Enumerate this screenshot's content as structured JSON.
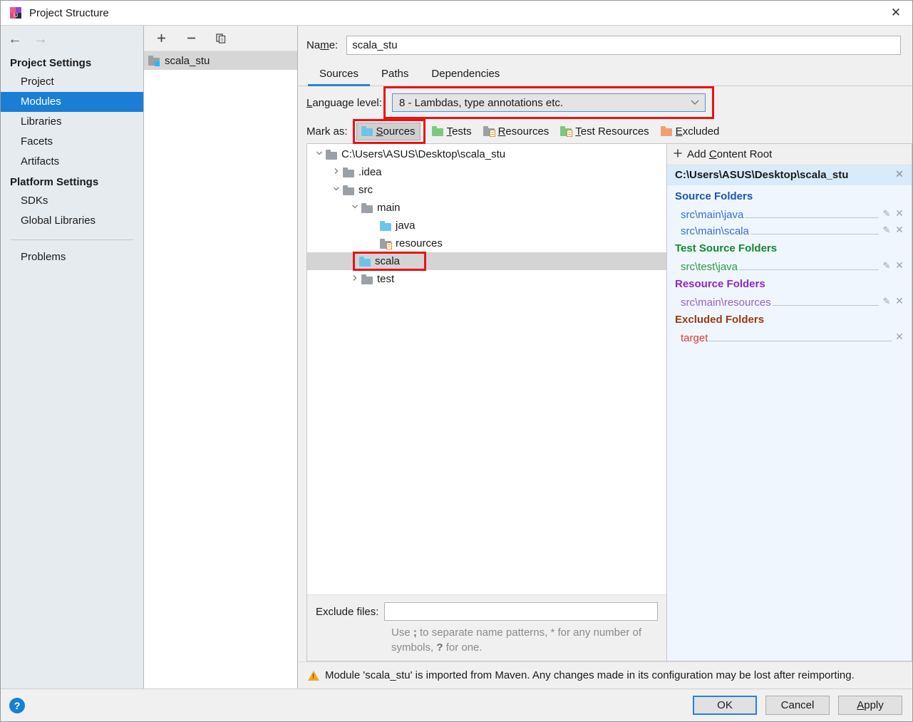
{
  "window": {
    "title": "Project Structure",
    "app_icon": "intellij-idea-icon",
    "close_label": "✕"
  },
  "sidebar": {
    "nav": {
      "back": "←",
      "forward": "→"
    },
    "groups": [
      {
        "title": "Project Settings",
        "items": [
          {
            "label": "Project",
            "selected": false
          },
          {
            "label": "Modules",
            "selected": true
          },
          {
            "label": "Libraries",
            "selected": false
          },
          {
            "label": "Facets",
            "selected": false
          },
          {
            "label": "Artifacts",
            "selected": false
          }
        ]
      },
      {
        "title": "Platform Settings",
        "items": [
          {
            "label": "SDKs",
            "selected": false
          },
          {
            "label": "Global Libraries",
            "selected": false
          }
        ]
      }
    ],
    "problems_label": "Problems"
  },
  "module_list": {
    "toolbar": {
      "add": "+",
      "remove": "−",
      "copy": "⎘"
    },
    "modules": [
      {
        "label": "scala_stu",
        "selected": true
      }
    ]
  },
  "module_panel": {
    "name_label": "Na",
    "name_label_mnemonic": "m",
    "name_label_rest": "e:",
    "name_value": "scala_stu",
    "tabs": [
      {
        "label": "Sources",
        "active": true
      },
      {
        "label": "Paths",
        "active": false
      },
      {
        "label": "Dependencies",
        "active": false
      }
    ],
    "language_level": {
      "label_mnemonic": "L",
      "label_rest": "anguage level:",
      "value": "8 - Lambdas, type annotations etc.",
      "chevron": "⌄",
      "highlighted": true
    },
    "mark_as": {
      "label": "Mark as:",
      "options": [
        {
          "pre": "",
          "mnemonic": "S",
          "post": "ources",
          "icon": "folder-blue-icon",
          "active": true
        },
        {
          "pre": "",
          "mnemonic": "T",
          "post": "ests",
          "icon": "folder-green-icon",
          "active": false
        },
        {
          "pre": "",
          "mnemonic": "R",
          "post": "esources",
          "icon": "folder-gray-lines-icon",
          "active": false
        },
        {
          "pre": "",
          "mnemonic": "T",
          "post": "est Resources",
          "icon": "folder-green-lines-icon",
          "active": false
        },
        {
          "pre": "",
          "mnemonic": "E",
          "post": "xcluded",
          "icon": "folder-orange-icon",
          "active": false
        }
      ]
    }
  },
  "tree": [
    {
      "label": "C:\\Users\\ASUS\\Desktop\\scala_stu",
      "depth": 0,
      "twist": "expanded",
      "icon": "folder-gray-icon",
      "selected": false
    },
    {
      "label": ".idea",
      "depth": 1,
      "twist": "collapsed",
      "icon": "folder-gray-icon",
      "selected": false
    },
    {
      "label": "src",
      "depth": 1,
      "twist": "expanded",
      "icon": "folder-gray-icon",
      "selected": false
    },
    {
      "label": "main",
      "depth": 2,
      "twist": "expanded",
      "icon": "folder-gray-icon",
      "selected": false
    },
    {
      "label": "java",
      "depth": 3,
      "twist": "none",
      "icon": "folder-blue-icon",
      "selected": false
    },
    {
      "label": "resources",
      "depth": 3,
      "twist": "none",
      "icon": "folder-gray-lines-icon",
      "selected": false
    },
    {
      "label": "scala",
      "depth": 3,
      "twist": "none",
      "icon": "folder-blue-icon",
      "selected": true,
      "highlighted": true
    },
    {
      "label": "test",
      "depth": 1,
      "twist": "collapsed",
      "icon": "folder-gray-icon",
      "selected": false
    }
  ],
  "exclude": {
    "label": "Exclude files:",
    "value": "",
    "hint_1": "Use ",
    "hint_sep": ";",
    "hint_2": " to separate name patterns, * for any number of symbols, ",
    "hint_q": "?",
    "hint_3": " for one."
  },
  "content_roots": {
    "add_label_pre": "Add ",
    "add_label_mnemonic": "C",
    "add_label_post": "ontent Root",
    "add_icon": "plus-icon",
    "root_path": "C:\\Users\\ASUS\\Desktop\\scala_stu",
    "sections": [
      {
        "title": "Source Folders",
        "kind": "src",
        "folders": [
          {
            "path": "src\\main\\java",
            "has_pencil": true
          },
          {
            "path": "src\\main\\scala",
            "has_pencil": true
          }
        ]
      },
      {
        "title": "Test Source Folders",
        "kind": "test",
        "folders": [
          {
            "path": "src\\test\\java",
            "has_pencil": true
          }
        ]
      },
      {
        "title": "Resource Folders",
        "kind": "res",
        "folders": [
          {
            "path": "src\\main\\resources",
            "has_pencil": true
          }
        ]
      },
      {
        "title": "Excluded Folders",
        "kind": "exc",
        "folders": [
          {
            "path": "target",
            "has_pencil": false
          }
        ]
      }
    ]
  },
  "warning": {
    "icon": "warning-triangle-icon",
    "text": "Module 'scala_stu' is imported from Maven. Any changes made in its configuration may be lost after reimporting."
  },
  "footer": {
    "help_label": "?",
    "buttons": [
      {
        "label": "OK",
        "default": true
      },
      {
        "label": "Cancel",
        "default": false
      },
      {
        "label": "Appl",
        "mnemonic": "A",
        "default": false
      }
    ],
    "ok_label": "OK",
    "cancel_label": "Cancel",
    "apply_pre": "",
    "apply_mnemonic": "A",
    "apply_post": "pply"
  },
  "colors": {
    "accent": "#1a7fd4",
    "highlight_red": "#ee1111",
    "tab_underline": "#2d7fd3",
    "source_blue": "#3a6fd0",
    "test_green": "#2e9a48",
    "resource_purple": "#9b5fcc",
    "excluded_red": "#e53935",
    "warning_amber": "#f0a81e"
  }
}
